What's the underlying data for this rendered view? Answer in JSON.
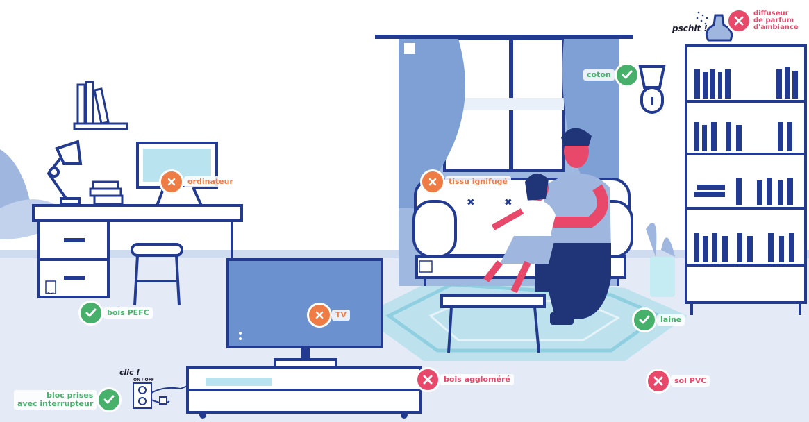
{
  "scene": {
    "badges": {
      "diffuseur": {
        "status": "bad",
        "label": "diffuseur\nde parfum\nd'ambiance"
      },
      "coton": {
        "status": "ok",
        "label": "coton"
      },
      "ordinateur": {
        "status": "warn",
        "label": "ordinateur"
      },
      "tissu": {
        "status": "warn",
        "label": "tissu ignifugé"
      },
      "bois_pefc": {
        "status": "ok",
        "label": "bois PEFC"
      },
      "tv": {
        "status": "warn",
        "label": "TV"
      },
      "laine": {
        "status": "ok",
        "label": "laine"
      },
      "bois_agglo": {
        "status": "bad",
        "label": "bois aggloméré"
      },
      "sol_pvc": {
        "status": "bad",
        "label": "sol PVC"
      },
      "bloc_prises": {
        "status": "ok",
        "label": "bloc prises\navec interrupteur"
      }
    },
    "sfx": {
      "pschit": "pschit !",
      "clic": "clic !",
      "on_off": "ON / OFF"
    },
    "logos": {
      "pefc": "PEFC"
    },
    "colors": {
      "ok": "#47b06b",
      "warn": "#ef7b45",
      "bad": "#e8486a",
      "navy": "#223a8f",
      "light_blue": "#b9cbe8",
      "floor": "#e4ebf6"
    }
  }
}
